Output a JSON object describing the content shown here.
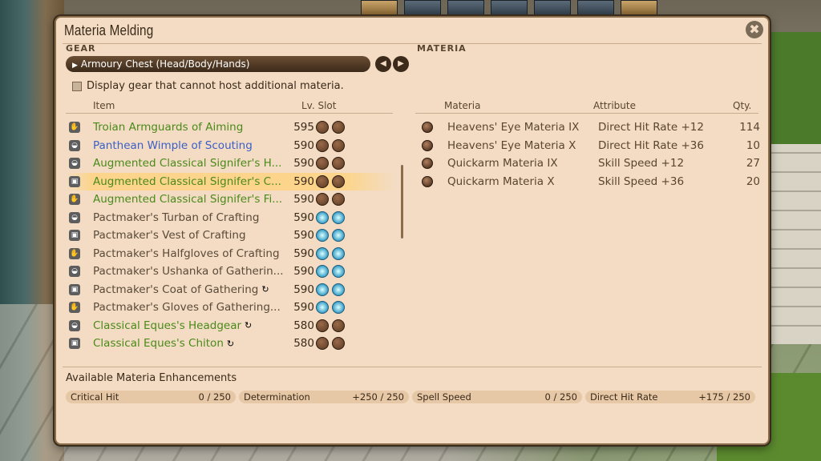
{
  "window": {
    "title": "Materia Melding",
    "close_icon": "close-icon"
  },
  "gear": {
    "section_label": "GEAR",
    "category": "Armoury Chest (Head/Body/Hands)",
    "checkbox_label": "Display gear that cannot host additional materia.",
    "columns": {
      "item": "Item",
      "lv_slot": "Lv. Slot"
    },
    "items": [
      {
        "name": "Troian Armguards of Aiming",
        "lv": "595",
        "color": "green",
        "icon": "hands-icon",
        "slots": [
          "brown",
          "brown"
        ]
      },
      {
        "name": "Panthean Wimple of Scouting",
        "lv": "590",
        "color": "blue",
        "icon": "head-icon",
        "slots": [
          "brown",
          "brown"
        ]
      },
      {
        "name": "Augmented Classical Signifer's H...",
        "lv": "590",
        "color": "green",
        "icon": "head-icon",
        "slots": [
          "brown",
          "brown"
        ]
      },
      {
        "name": "Augmented Classical Signifer's C...",
        "lv": "590",
        "color": "green",
        "icon": "body-icon",
        "slots": [
          "brown",
          "brown"
        ],
        "selected": true
      },
      {
        "name": "Augmented Classical Signifer's Fi...",
        "lv": "590",
        "color": "green",
        "icon": "hands-icon",
        "slots": [
          "brown",
          "brown"
        ]
      },
      {
        "name": "Pactmaker's Turban of Crafting",
        "lv": "590",
        "color": "gray",
        "icon": "head-icon",
        "slots": [
          "cyan",
          "cyan"
        ]
      },
      {
        "name": "Pactmaker's Vest of Crafting",
        "lv": "590",
        "color": "gray",
        "icon": "body-icon",
        "slots": [
          "cyan",
          "cyan"
        ]
      },
      {
        "name": "Pactmaker's Halfgloves of Crafting",
        "lv": "590",
        "color": "gray",
        "icon": "hands-icon",
        "slots": [
          "cyan",
          "cyan"
        ]
      },
      {
        "name": "Pactmaker's Ushanka of Gatherin...",
        "lv": "590",
        "color": "gray",
        "icon": "head-icon",
        "slots": [
          "cyan",
          "cyan"
        ]
      },
      {
        "name": "Pactmaker's Coat of Gathering",
        "lv": "590",
        "color": "gray",
        "icon": "body-icon",
        "slots": [
          "cyan",
          "cyan"
        ],
        "glamour": true
      },
      {
        "name": "Pactmaker's Gloves of Gathering...",
        "lv": "590",
        "color": "gray",
        "icon": "hands-icon",
        "slots": [
          "cyan",
          "cyan"
        ]
      },
      {
        "name": "Classical Eques's Headgear",
        "lv": "580",
        "color": "green",
        "icon": "head-icon",
        "slots": [
          "brown",
          "brown"
        ],
        "glamour": true
      },
      {
        "name": "Classical Eques's Chiton",
        "lv": "580",
        "color": "green",
        "icon": "body-icon",
        "slots": [
          "brown",
          "brown"
        ],
        "glamour": true
      }
    ]
  },
  "materia": {
    "section_label": "MATERIA",
    "columns": {
      "materia": "Materia",
      "attribute": "Attribute",
      "qty": "Qty."
    },
    "items": [
      {
        "name": "Heavens' Eye Materia IX",
        "attribute": "Direct Hit Rate +12",
        "qty": "114"
      },
      {
        "name": "Heavens' Eye Materia X",
        "attribute": "Direct Hit Rate +36",
        "qty": "10"
      },
      {
        "name": "Quickarm Materia IX",
        "attribute": "Skill Speed +12",
        "qty": "27"
      },
      {
        "name": "Quickarm Materia X",
        "attribute": "Skill Speed +36",
        "qty": "20"
      }
    ]
  },
  "enhancements": {
    "title": "Available Materia Enhancements",
    "stats": [
      {
        "label": "Critical Hit",
        "value": "0  /  250"
      },
      {
        "label": "Determination",
        "value": "+250  /  250"
      },
      {
        "label": "Spell Speed",
        "value": "0  /  250"
      },
      {
        "label": "Direct Hit Rate",
        "value": "+175  /  250"
      }
    ]
  },
  "colors": {
    "green": "#4a8a1a",
    "blue": "#3a5fc8",
    "gray": "#5a4a3a",
    "panel": "#f3dcc3"
  }
}
